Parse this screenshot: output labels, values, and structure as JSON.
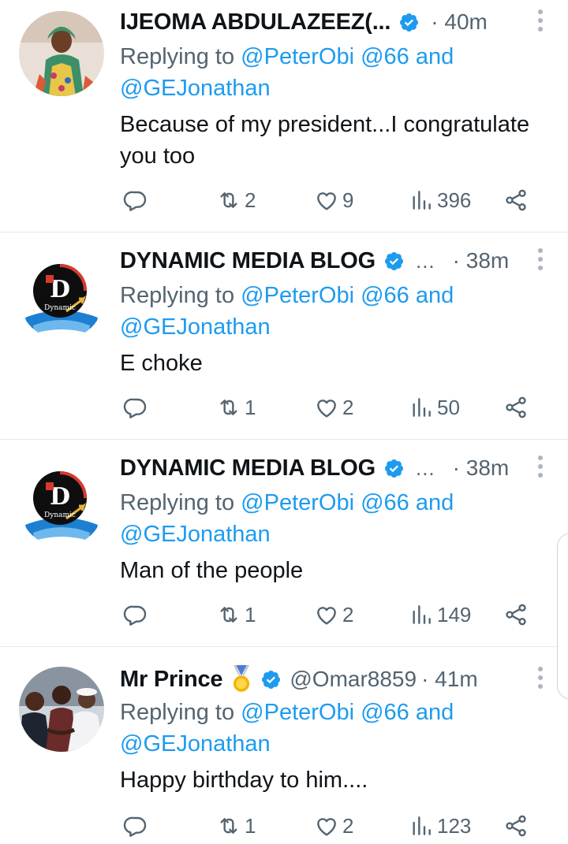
{
  "tweets": [
    {
      "name": "IJEOMA ABDULAZEEZ(...",
      "handle": "",
      "ellipsis": "",
      "time": "· 40m",
      "replying_prefix": "Replying to",
      "mention1": "@PeterObi",
      "mention2": "@66",
      "and": "and",
      "mention3": "@GEJonathan",
      "text": "Because of my president...I congratulate you too",
      "replies": "",
      "retweets": "2",
      "likes": "9",
      "views": "396"
    },
    {
      "name": "DYNAMIC MEDIA BLOG",
      "handle": "",
      "ellipsis": "...",
      "time": "· 38m",
      "replying_prefix": "Replying to",
      "mention1": "@PeterObi",
      "mention2": "@66",
      "and": "and",
      "mention3": "@GEJonathan",
      "text": "E choke",
      "replies": "",
      "retweets": "1",
      "likes": "2",
      "views": "50"
    },
    {
      "name": "DYNAMIC MEDIA BLOG",
      "handle": "",
      "ellipsis": "...",
      "time": "· 38m",
      "replying_prefix": "Replying to",
      "mention1": "@PeterObi",
      "mention2": "@66",
      "and": "and",
      "mention3": "@GEJonathan",
      "text": "Man of the people",
      "replies": "",
      "retweets": "1",
      "likes": "2",
      "views": "149"
    },
    {
      "name": "Mr Prince",
      "handle": "@Omar8859",
      "ellipsis": "",
      "time": "· 41m",
      "replying_prefix": "Replying to",
      "mention1": "@PeterObi",
      "mention2": "@66",
      "and": "and",
      "mention3": "@GEJonathan",
      "text": "Happy birthday to him....",
      "replies": "",
      "retweets": "1",
      "likes": "2",
      "views": "123"
    }
  ],
  "logo_text": "Dynamic",
  "colors": {
    "accent": "#1d9bf0",
    "secondary_text": "#536471",
    "primary_text": "#0f1419",
    "divider": "#e7e9ea"
  },
  "icons": {
    "verified": "verified-badge-icon",
    "medal": "medal-icon",
    "reply": "reply-icon",
    "retweet": "retweet-icon",
    "like": "heart-icon",
    "views": "views-icon",
    "share": "share-icon",
    "more": "more-vertical-icon"
  }
}
